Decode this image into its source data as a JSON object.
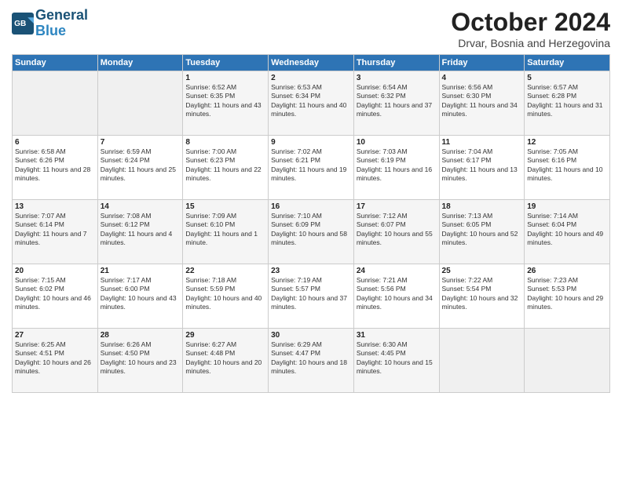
{
  "logo": {
    "line1": "General",
    "line2": "Blue"
  },
  "header": {
    "month": "October 2024",
    "location": "Drvar, Bosnia and Herzegovina"
  },
  "weekdays": [
    "Sunday",
    "Monday",
    "Tuesday",
    "Wednesday",
    "Thursday",
    "Friday",
    "Saturday"
  ],
  "weeks": [
    [
      {
        "day": "",
        "sunrise": "",
        "sunset": "",
        "daylight": ""
      },
      {
        "day": "",
        "sunrise": "",
        "sunset": "",
        "daylight": ""
      },
      {
        "day": "1",
        "sunrise": "Sunrise: 6:52 AM",
        "sunset": "Sunset: 6:35 PM",
        "daylight": "Daylight: 11 hours and 43 minutes."
      },
      {
        "day": "2",
        "sunrise": "Sunrise: 6:53 AM",
        "sunset": "Sunset: 6:34 PM",
        "daylight": "Daylight: 11 hours and 40 minutes."
      },
      {
        "day": "3",
        "sunrise": "Sunrise: 6:54 AM",
        "sunset": "Sunset: 6:32 PM",
        "daylight": "Daylight: 11 hours and 37 minutes."
      },
      {
        "day": "4",
        "sunrise": "Sunrise: 6:56 AM",
        "sunset": "Sunset: 6:30 PM",
        "daylight": "Daylight: 11 hours and 34 minutes."
      },
      {
        "day": "5",
        "sunrise": "Sunrise: 6:57 AM",
        "sunset": "Sunset: 6:28 PM",
        "daylight": "Daylight: 11 hours and 31 minutes."
      }
    ],
    [
      {
        "day": "6",
        "sunrise": "Sunrise: 6:58 AM",
        "sunset": "Sunset: 6:26 PM",
        "daylight": "Daylight: 11 hours and 28 minutes."
      },
      {
        "day": "7",
        "sunrise": "Sunrise: 6:59 AM",
        "sunset": "Sunset: 6:24 PM",
        "daylight": "Daylight: 11 hours and 25 minutes."
      },
      {
        "day": "8",
        "sunrise": "Sunrise: 7:00 AM",
        "sunset": "Sunset: 6:23 PM",
        "daylight": "Daylight: 11 hours and 22 minutes."
      },
      {
        "day": "9",
        "sunrise": "Sunrise: 7:02 AM",
        "sunset": "Sunset: 6:21 PM",
        "daylight": "Daylight: 11 hours and 19 minutes."
      },
      {
        "day": "10",
        "sunrise": "Sunrise: 7:03 AM",
        "sunset": "Sunset: 6:19 PM",
        "daylight": "Daylight: 11 hours and 16 minutes."
      },
      {
        "day": "11",
        "sunrise": "Sunrise: 7:04 AM",
        "sunset": "Sunset: 6:17 PM",
        "daylight": "Daylight: 11 hours and 13 minutes."
      },
      {
        "day": "12",
        "sunrise": "Sunrise: 7:05 AM",
        "sunset": "Sunset: 6:16 PM",
        "daylight": "Daylight: 11 hours and 10 minutes."
      }
    ],
    [
      {
        "day": "13",
        "sunrise": "Sunrise: 7:07 AM",
        "sunset": "Sunset: 6:14 PM",
        "daylight": "Daylight: 11 hours and 7 minutes."
      },
      {
        "day": "14",
        "sunrise": "Sunrise: 7:08 AM",
        "sunset": "Sunset: 6:12 PM",
        "daylight": "Daylight: 11 hours and 4 minutes."
      },
      {
        "day": "15",
        "sunrise": "Sunrise: 7:09 AM",
        "sunset": "Sunset: 6:10 PM",
        "daylight": "Daylight: 11 hours and 1 minute."
      },
      {
        "day": "16",
        "sunrise": "Sunrise: 7:10 AM",
        "sunset": "Sunset: 6:09 PM",
        "daylight": "Daylight: 10 hours and 58 minutes."
      },
      {
        "day": "17",
        "sunrise": "Sunrise: 7:12 AM",
        "sunset": "Sunset: 6:07 PM",
        "daylight": "Daylight: 10 hours and 55 minutes."
      },
      {
        "day": "18",
        "sunrise": "Sunrise: 7:13 AM",
        "sunset": "Sunset: 6:05 PM",
        "daylight": "Daylight: 10 hours and 52 minutes."
      },
      {
        "day": "19",
        "sunrise": "Sunrise: 7:14 AM",
        "sunset": "Sunset: 6:04 PM",
        "daylight": "Daylight: 10 hours and 49 minutes."
      }
    ],
    [
      {
        "day": "20",
        "sunrise": "Sunrise: 7:15 AM",
        "sunset": "Sunset: 6:02 PM",
        "daylight": "Daylight: 10 hours and 46 minutes."
      },
      {
        "day": "21",
        "sunrise": "Sunrise: 7:17 AM",
        "sunset": "Sunset: 6:00 PM",
        "daylight": "Daylight: 10 hours and 43 minutes."
      },
      {
        "day": "22",
        "sunrise": "Sunrise: 7:18 AM",
        "sunset": "Sunset: 5:59 PM",
        "daylight": "Daylight: 10 hours and 40 minutes."
      },
      {
        "day": "23",
        "sunrise": "Sunrise: 7:19 AM",
        "sunset": "Sunset: 5:57 PM",
        "daylight": "Daylight: 10 hours and 37 minutes."
      },
      {
        "day": "24",
        "sunrise": "Sunrise: 7:21 AM",
        "sunset": "Sunset: 5:56 PM",
        "daylight": "Daylight: 10 hours and 34 minutes."
      },
      {
        "day": "25",
        "sunrise": "Sunrise: 7:22 AM",
        "sunset": "Sunset: 5:54 PM",
        "daylight": "Daylight: 10 hours and 32 minutes."
      },
      {
        "day": "26",
        "sunrise": "Sunrise: 7:23 AM",
        "sunset": "Sunset: 5:53 PM",
        "daylight": "Daylight: 10 hours and 29 minutes."
      }
    ],
    [
      {
        "day": "27",
        "sunrise": "Sunrise: 6:25 AM",
        "sunset": "Sunset: 4:51 PM",
        "daylight": "Daylight: 10 hours and 26 minutes."
      },
      {
        "day": "28",
        "sunrise": "Sunrise: 6:26 AM",
        "sunset": "Sunset: 4:50 PM",
        "daylight": "Daylight: 10 hours and 23 minutes."
      },
      {
        "day": "29",
        "sunrise": "Sunrise: 6:27 AM",
        "sunset": "Sunset: 4:48 PM",
        "daylight": "Daylight: 10 hours and 20 minutes."
      },
      {
        "day": "30",
        "sunrise": "Sunrise: 6:29 AM",
        "sunset": "Sunset: 4:47 PM",
        "daylight": "Daylight: 10 hours and 18 minutes."
      },
      {
        "day": "31",
        "sunrise": "Sunrise: 6:30 AM",
        "sunset": "Sunset: 4:45 PM",
        "daylight": "Daylight: 10 hours and 15 minutes."
      },
      {
        "day": "",
        "sunrise": "",
        "sunset": "",
        "daylight": ""
      },
      {
        "day": "",
        "sunrise": "",
        "sunset": "",
        "daylight": ""
      }
    ]
  ]
}
